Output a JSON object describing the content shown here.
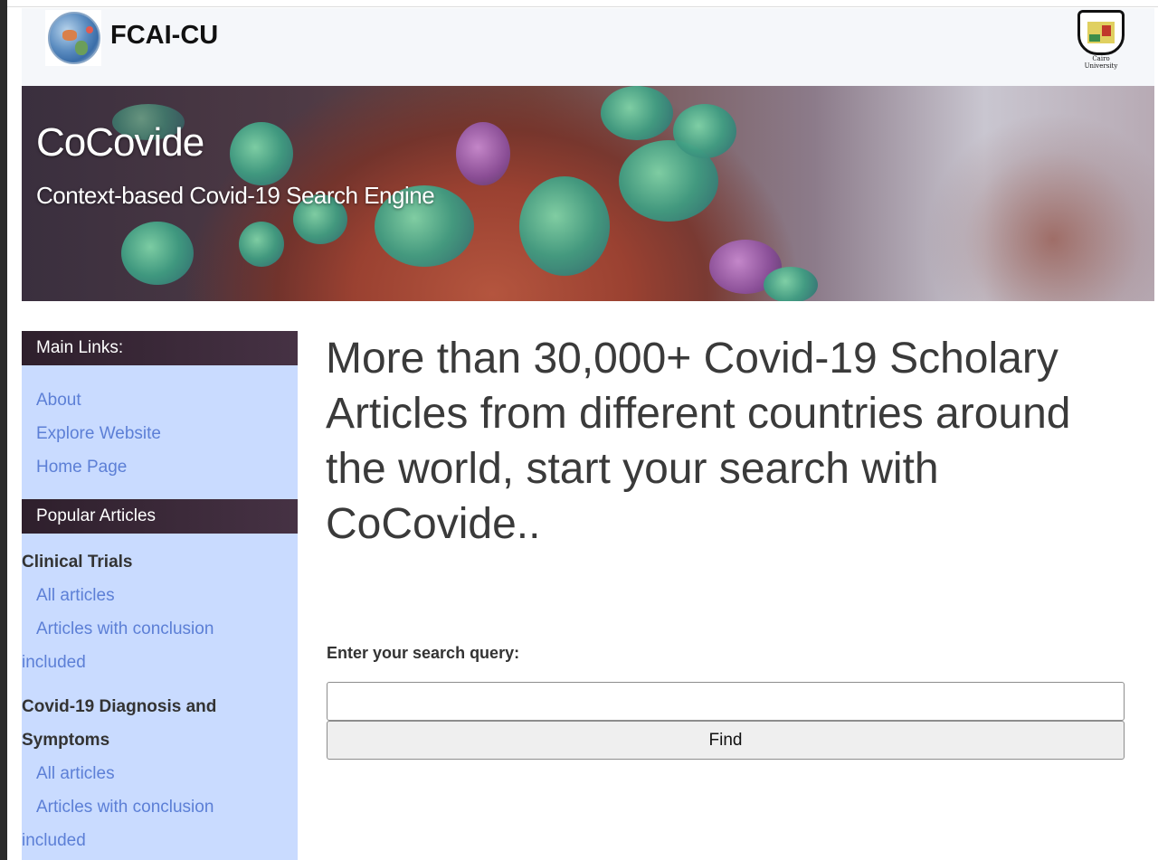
{
  "header": {
    "brand": "FCAI-CU",
    "university_logo_text": "Cairo University"
  },
  "hero": {
    "title": "CoCovide",
    "subtitle": "Context-based Covid-19 Search Engine"
  },
  "sidebar": {
    "main_links_header": "Main Links:",
    "main_links": [
      "About",
      "Explore Website",
      "Home Page"
    ],
    "popular_header": "Popular Articles",
    "categories": [
      {
        "title_lines": [
          "Clinical Trials"
        ],
        "links": [
          "All articles",
          "Articles with conclusion",
          "included"
        ]
      },
      {
        "title_lines": [
          "Covid-19 Diagnosis and",
          "Symptoms"
        ],
        "links": [
          "All articles",
          "Articles with conclusion",
          "included"
        ]
      }
    ]
  },
  "main": {
    "heading": "More than 30,000+ Covid-19 Scholary Articles from different countries around the world, start your search with CoCovide..",
    "search_label": "Enter your search query:",
    "search_value": "",
    "find_label": "Find"
  },
  "colors": {
    "sidebar_bg": "#c9dbff",
    "sidebar_header_bg": "#2e1f2c",
    "link": "#5c7fd6",
    "topbar_bg": "#f5f7fa"
  }
}
